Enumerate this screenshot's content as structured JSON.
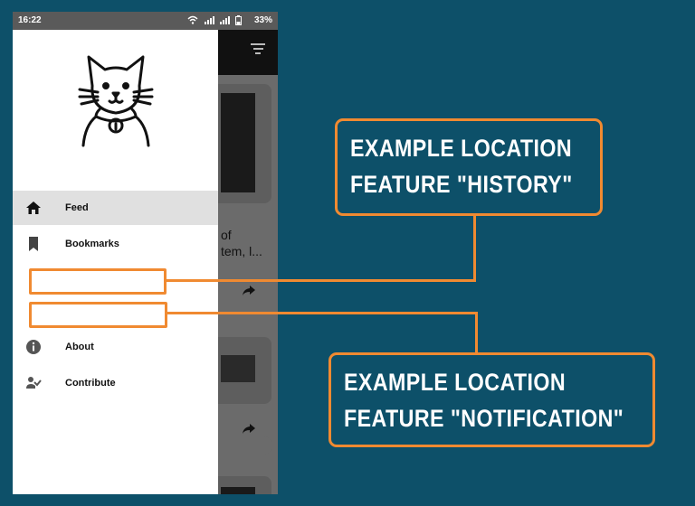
{
  "status_bar": {
    "time": "16:22",
    "battery": "33%"
  },
  "drawer": {
    "items": [
      {
        "label": "Feed",
        "icon": "home-icon",
        "active": true
      },
      {
        "label": "Bookmarks",
        "icon": "bookmark-icon",
        "active": false
      },
      {
        "label": "About",
        "icon": "info-icon",
        "active": false
      },
      {
        "label": "Contribute",
        "icon": "contribute-icon",
        "active": false
      }
    ]
  },
  "background_feed": {
    "card_text_line1": "of",
    "card_text_line2": "tem, l..."
  },
  "callouts": {
    "history": {
      "line1": "EXAMPLE LOCATION",
      "line2": "FEATURE \"HISTORY\""
    },
    "notification": {
      "line1": "EXAMPLE LOCATION",
      "line2": "FEATURE \"NOTIFICATION\""
    }
  },
  "colors": {
    "background": "#0d5069",
    "accent": "#f08a31",
    "drawer_active": "#e0e0e0"
  }
}
